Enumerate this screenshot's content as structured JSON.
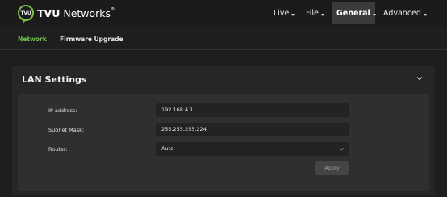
{
  "brand": {
    "badge": "TVU",
    "name": "Networks",
    "trademark": "®",
    "accent": "#7bc043"
  },
  "nav": {
    "live": "Live",
    "file": "File",
    "general": "General",
    "advanced": "Advanced",
    "active": "General"
  },
  "subtabs": {
    "network": "Network",
    "firmware": "Firmware Upgrade",
    "active": "Network",
    "active_color": "#6fbf4a"
  },
  "lan": {
    "title": "LAN Settings",
    "ip_label": "IP address:",
    "ip_value": "192.168.4.1",
    "mask_label": "Subnet Mask:",
    "mask_value": "255.255.255.224",
    "router_label": "Router:",
    "router_value": "Auto",
    "apply_label": "Apply"
  },
  "icons": {
    "collapse": "chevron-down-icon",
    "select": "chevron-down-icon",
    "nav_caret": "caret-down-icon"
  }
}
